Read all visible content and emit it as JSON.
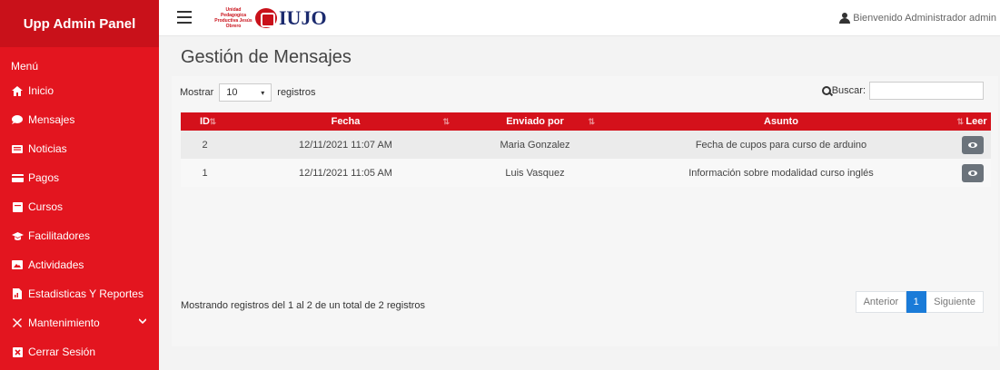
{
  "sidebar": {
    "brand": "Upp Admin Panel",
    "menu_title": "Menú",
    "items": [
      {
        "label": "Inicio",
        "icon": "home-icon"
      },
      {
        "label": "Mensajes",
        "icon": "chat-bubble-icon"
      },
      {
        "label": "Noticias",
        "icon": "newspaper-icon"
      },
      {
        "label": "Pagos",
        "icon": "credit-card-icon"
      },
      {
        "label": "Cursos",
        "icon": "book-icon"
      },
      {
        "label": "Facilitadores",
        "icon": "graduation-cap-icon"
      },
      {
        "label": "Actividades",
        "icon": "image-icon"
      },
      {
        "label": "Estadisticas Y Reportes",
        "icon": "file-chart-icon"
      },
      {
        "label": "Mantenimiento",
        "icon": "tools-icon"
      },
      {
        "label": "Cerrar Sesión",
        "icon": "close-box-icon"
      }
    ]
  },
  "topbar": {
    "logo_text": "Unidad Pedagogica Productiva Jesús Obrero",
    "logo_iujo": "IUJO",
    "welcome": "Bienvenido Administrador admin"
  },
  "page": {
    "title": "Gestión de Mensajes",
    "show_label": "Mostrar",
    "show_value": "10",
    "show_suffix": "registros",
    "search_label": "Buscar:",
    "search_value": ""
  },
  "table": {
    "headers": [
      "ID",
      "Fecha",
      "Enviado por",
      "Asunto",
      "Leer"
    ],
    "rows": [
      {
        "id": "2",
        "fecha": "12/11/2021 11:07 AM",
        "enviado": "Maria Gonzalez",
        "asunto": "Fecha de cupos para curso de arduino"
      },
      {
        "id": "1",
        "fecha": "12/11/2021 11:05 AM",
        "enviado": "Luis Vasquez",
        "asunto": "Información sobre modalidad curso inglés"
      }
    ]
  },
  "footer": {
    "info": "Mostrando registros del 1 al 2 de un total de 2 registros",
    "prev": "Anterior",
    "current": "1",
    "next": "Siguiente"
  },
  "colors": {
    "sidebar": "#e3151f",
    "header_row": "#d4111b",
    "active_page": "#1a7bd8"
  }
}
